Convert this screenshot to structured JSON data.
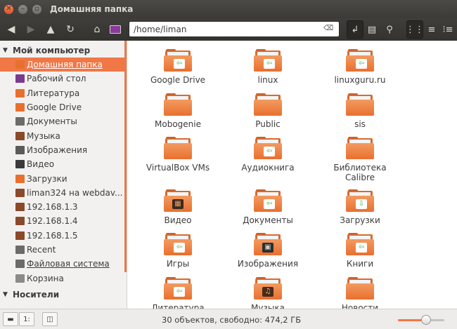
{
  "window": {
    "title": "Домашняя папка"
  },
  "toolbar": {
    "path": "/home/liman",
    "icons": [
      "back-icon",
      "forward-icon",
      "up-icon",
      "reload-icon",
      "home-icon",
      "desktop-icon",
      "terminal-icon",
      "bookmark-folder-icon",
      "search-icon",
      "grid-view-icon",
      "list-view-icon",
      "compact-view-icon"
    ]
  },
  "sidebar": {
    "sections": [
      {
        "title": "Мой компьютер",
        "items": [
          {
            "label": "Домашняя папка",
            "icon": "home-folder-icon",
            "color": "#e8702f",
            "selected": true
          },
          {
            "label": "Рабочий стол",
            "icon": "desktop-icon",
            "color": "#7b3a8c"
          },
          {
            "label": "Литература",
            "icon": "folder-icon",
            "color": "#e8702f"
          },
          {
            "label": "Google Drive",
            "icon": "folder-icon",
            "color": "#e8702f"
          },
          {
            "label": "Документы",
            "icon": "documents-icon",
            "color": "#6b6b6b"
          },
          {
            "label": "Музыка",
            "icon": "music-icon",
            "color": "#8a4a2a"
          },
          {
            "label": "Изображения",
            "icon": "pictures-icon",
            "color": "#5a5a5a"
          },
          {
            "label": "Видео",
            "icon": "video-icon",
            "color": "#3a3a3a"
          },
          {
            "label": "Загрузки",
            "icon": "downloads-icon",
            "color": "#e8702f"
          },
          {
            "label": "liman324 на webdav...",
            "icon": "network-drive-icon",
            "color": "#8a4a2a"
          },
          {
            "label": "192.168.1.3",
            "icon": "network-drive-icon",
            "color": "#8a4a2a"
          },
          {
            "label": "192.168.1.4",
            "icon": "network-drive-icon",
            "color": "#8a4a2a"
          },
          {
            "label": "192.168.1.5",
            "icon": "network-drive-icon",
            "color": "#8a4a2a"
          },
          {
            "label": "Recent",
            "icon": "clock-icon",
            "color": "#6b6b6b"
          },
          {
            "label": "Файловая система",
            "icon": "drive-icon",
            "color": "#6b6b6b"
          },
          {
            "label": "Корзина",
            "icon": "trash-icon",
            "color": "#8a8a8a"
          }
        ]
      },
      {
        "title": "Носители",
        "items": []
      }
    ]
  },
  "files": [
    {
      "name": "Google Drive",
      "emblem": "link"
    },
    {
      "name": "linux",
      "emblem": "link"
    },
    {
      "name": "linuxguru.ru",
      "emblem": "link"
    },
    {
      "name": "Mobogenie",
      "emblem": ""
    },
    {
      "name": "Public",
      "emblem": ""
    },
    {
      "name": "sis",
      "emblem": ""
    },
    {
      "name": "VirtualBox VMs",
      "emblem": ""
    },
    {
      "name": "Аудиокнига",
      "emblem": "link"
    },
    {
      "name": "Библиотека Calibre",
      "emblem": ""
    },
    {
      "name": "Видео",
      "emblem": "video"
    },
    {
      "name": "Документы",
      "emblem": "document"
    },
    {
      "name": "Загрузки",
      "emblem": "download"
    },
    {
      "name": "Игры",
      "emblem": "link"
    },
    {
      "name": "Изображения",
      "emblem": "picture"
    },
    {
      "name": "Книги",
      "emblem": "link"
    },
    {
      "name": "Литература",
      "emblem": "document"
    },
    {
      "name": "Музыка",
      "emblem": "music"
    },
    {
      "name": "Новости",
      "emblem": ""
    }
  ],
  "statusbar": {
    "text": "30 объектов, свободно: 474,2 ГБ",
    "zoom": 0.6
  }
}
